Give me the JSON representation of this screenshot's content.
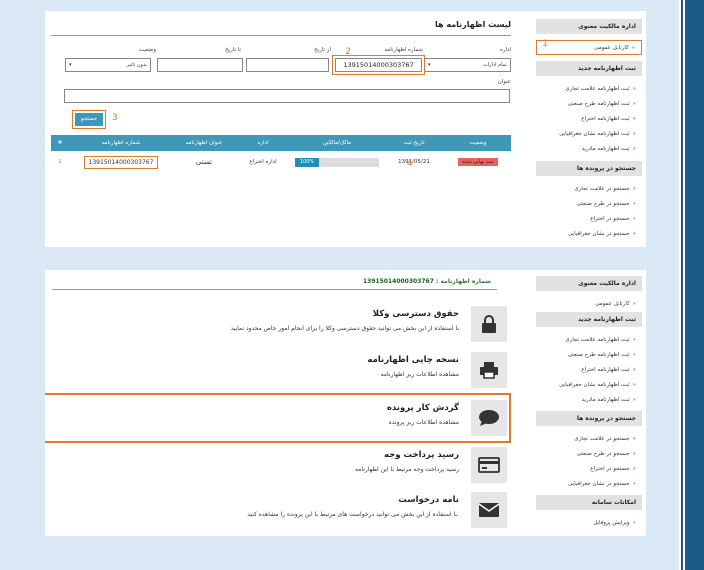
{
  "sidebar": {
    "section1": "اداره مالکیت معنوی",
    "item_kartabl": "کارتابل عمومی",
    "section2": "ثبت اظهارنامه جدید",
    "reg_items": [
      "ثبت اظهارنامه علامت تجاری",
      "ثبت اظهارنامه طرح صنعتی",
      "ثبت اظهارنامه اختراع",
      "ثبت اظهارنامه نشان جغرافیایی",
      "ثبت اظهارنامه مادرید"
    ],
    "section3": "جستجو در پرونده ها",
    "search_items": [
      "جستجو در علامت تجاری",
      "جستجو در طرح صنعتی",
      "جستجو در اختراع",
      "جستجو در نشان جغرافیایی"
    ],
    "section4": "امکانات سامانه",
    "settings_item": "ویرایش پروفایل"
  },
  "callouts": [
    "1",
    "2",
    "3",
    "4"
  ],
  "list": {
    "title": "لیست اظهارنامه ها",
    "label_office": "اداره",
    "office_value": "تمام ادارات",
    "label_appno": "شماره اظهارنامه",
    "appno_value": "13915014000303767",
    "label_fromdate": "از تاریخ",
    "label_todate": "تا تاریخ",
    "label_status": "وضعیت",
    "status_value": "بدون تاثیر",
    "label_title": "عنوان",
    "search_button": "جستجو",
    "columns": [
      "#",
      "شماره اظهارنامه",
      "عنوان اظهارنامه",
      "اداره",
      "مالک/مالکین",
      "تاریخ ثبت",
      "وضعیت"
    ],
    "row": {
      "index": "1",
      "appno": "13915014000303767",
      "title": "تستی",
      "office": "اداره اختراع",
      "progress": "100%",
      "progress_fraction": 1,
      "date": "1391/05/21",
      "status": "ثبت نهایی شده"
    }
  },
  "detail": {
    "header_label": "شماره اظهارنامه :",
    "header_value": "13915014000303767",
    "cards": [
      {
        "icon": "lock-icon",
        "title": "حقوق دسترسی وکلا",
        "desc": "با استفاده از این بخش می توانید حقوق دسترسی وکلا را برای انجام امور خاص محدود نمایید"
      },
      {
        "icon": "printer-icon",
        "title": "نسخه چاپی اظهارنامه",
        "desc": "مشاهده اطلاعات ریز اظهارنامه"
      },
      {
        "icon": "comment-icon",
        "title": "گردش کار پرونده",
        "desc": "مشاهده اطلاعات ریز پرونده"
      },
      {
        "icon": "credit-card-icon",
        "title": "رسید پرداخت وجه",
        "desc": "رسید پرداخت وجه مرتبط با این اظهارنامه"
      },
      {
        "icon": "envelope-icon",
        "title": "نامه درخواست",
        "desc": "با استفاده از این بخش می توانید درخواست های مرتبط با این پرونده را مشاهده کنید."
      }
    ]
  },
  "colors": {
    "accent": "#3e99b8",
    "highlight": "#e07a2c",
    "status_red": "#e8625a",
    "progress_blue": "#1f8fb8",
    "header_green": "#2e7d32"
  }
}
